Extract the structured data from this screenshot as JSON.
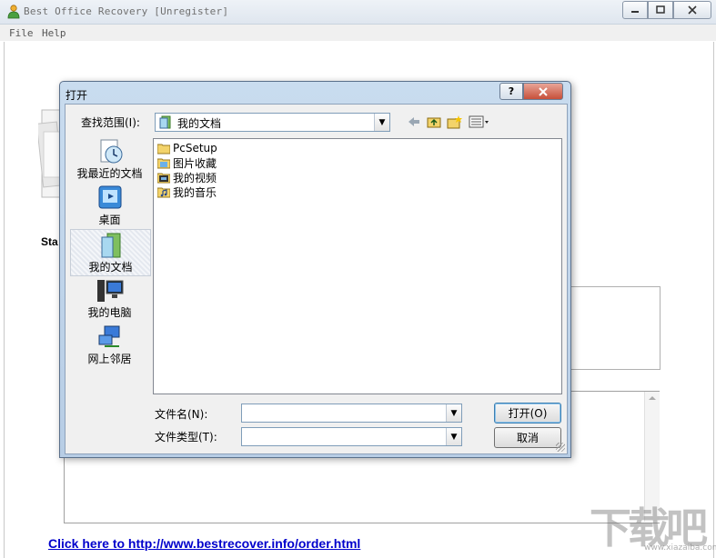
{
  "window": {
    "title": "Best Office Recovery [Unregister]",
    "menu": [
      "File",
      "Help"
    ]
  },
  "main": {
    "start_label": "Sta",
    "order_link": "Click here to http://www.bestrecover.info/order.html"
  },
  "watermark": {
    "text": "下载吧",
    "sub": "www.xiazaiba.com"
  },
  "dialog": {
    "title": "打开",
    "help_button": "?",
    "lookin_label": "查找范围(I):",
    "lookin_value": "我的文档",
    "places": [
      {
        "label": "我最近的文档",
        "icon": "recent-documents-icon"
      },
      {
        "label": "桌面",
        "icon": "desktop-icon"
      },
      {
        "label": "我的文档",
        "icon": "my-documents-icon"
      },
      {
        "label": "我的电脑",
        "icon": "my-computer-icon"
      },
      {
        "label": "网上邻居",
        "icon": "network-places-icon"
      }
    ],
    "files": [
      {
        "name": "PcSetup",
        "icon": "folder-icon"
      },
      {
        "name": "图片收藏",
        "icon": "pictures-folder-icon"
      },
      {
        "name": "我的视频",
        "icon": "videos-folder-icon"
      },
      {
        "name": "我的音乐",
        "icon": "music-folder-icon"
      }
    ],
    "filename_label": "文件名(N):",
    "filename_value": "",
    "filetype_label": "文件类型(T):",
    "filetype_value": "",
    "open_button": "打开(O)",
    "cancel_button": "取消"
  },
  "colors": {
    "link": "#0000cc",
    "dialog_frame": "#b7cde5",
    "close_button": "#c7503a"
  }
}
